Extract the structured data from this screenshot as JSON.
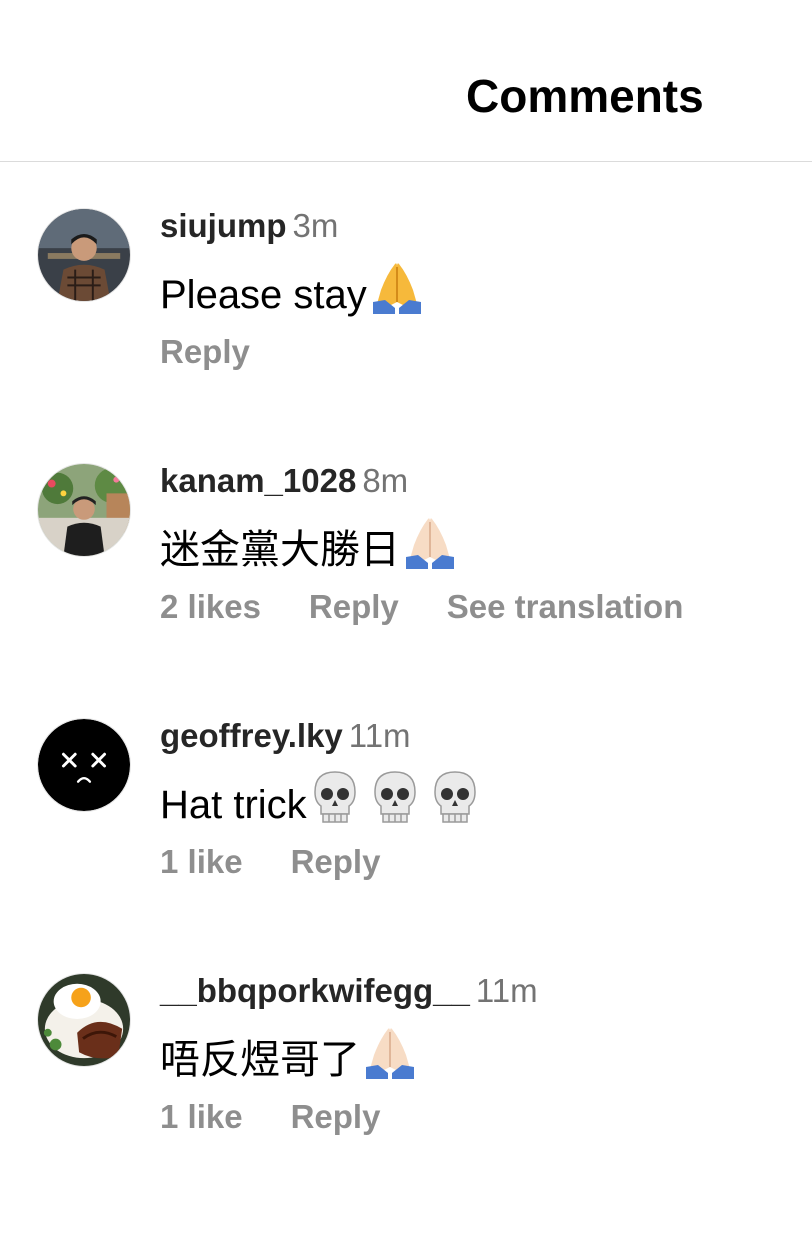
{
  "header": {
    "title": "Comments"
  },
  "comments": [
    {
      "username": "siujump",
      "time": "3m",
      "text": "Please stay",
      "emojis": [
        "folded-hands-icon"
      ],
      "reply_label": "Reply"
    },
    {
      "username": "kanam_1028",
      "time": "8m",
      "text": "迷金黨大勝日",
      "emojis": [
        "folded-hands-icon"
      ],
      "likes": "2 likes",
      "reply_label": "Reply",
      "translate_label": "See translation"
    },
    {
      "username": "geoffrey.lky",
      "time": "11m",
      "text": "Hat trick",
      "emojis": [
        "skull-icon",
        "skull-icon",
        "skull-icon"
      ],
      "likes": "1 like",
      "reply_label": "Reply"
    },
    {
      "username": "__bbqporkwifegg__",
      "time": "11m",
      "text": "唔反煜哥了",
      "emojis": [
        "folded-hands-icon"
      ],
      "likes": "1 like",
      "reply_label": "Reply"
    }
  ]
}
